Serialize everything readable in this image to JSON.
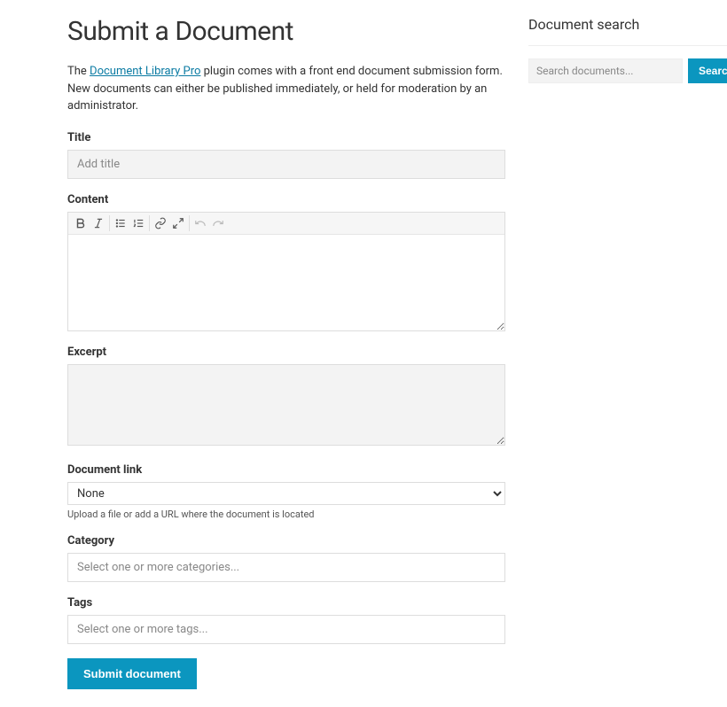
{
  "page": {
    "title": "Submit a Document",
    "intro_before": "The ",
    "intro_link": "Document Library Pro",
    "intro_after": " plugin comes with a front end document submission form. New documents can either be published immediately, or held for moderation by an administrator."
  },
  "form": {
    "title_label": "Title",
    "title_placeholder": "Add title",
    "content_label": "Content",
    "excerpt_label": "Excerpt",
    "doclink_label": "Document link",
    "doclink_value": "None",
    "doclink_helper": "Upload a file or add a URL where the document is located",
    "category_label": "Category",
    "category_placeholder": "Select one or more categories...",
    "tags_label": "Tags",
    "tags_placeholder": "Select one or more tags...",
    "submit_label": "Submit document"
  },
  "sidebar": {
    "heading": "Document search",
    "search_placeholder": "Search documents...",
    "search_button": "Search"
  }
}
